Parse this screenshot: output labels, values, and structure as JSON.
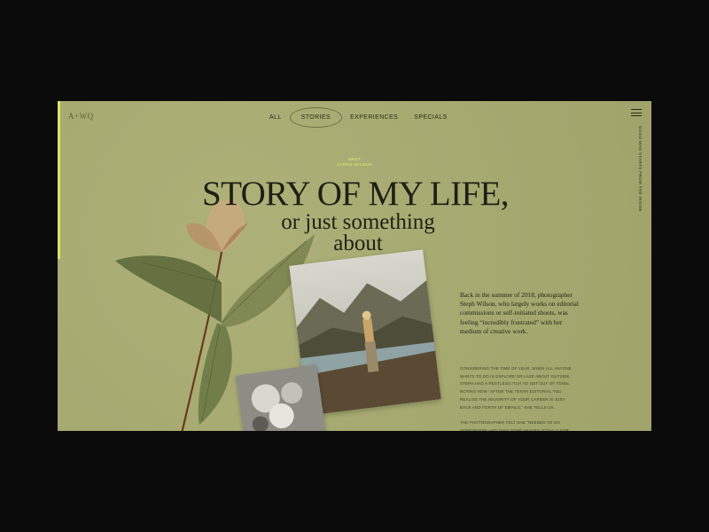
{
  "brand": {
    "logo": "A+WQ"
  },
  "nav": {
    "items": [
      "ALL",
      "STORIES",
      "EXPERIENCES",
      "SPECIALS"
    ],
    "active": "STORIES"
  },
  "side_text": "GOOD MAN STARTS FROM THE INSIDE",
  "hero": {
    "kicker_line1": "MEET",
    "kicker_line2": "STEPH WILSON",
    "title": "STORY OF MY LIFE,",
    "subtitle_line1": "or just something",
    "subtitle_line2": "about"
  },
  "article": {
    "intro": "Back in the summer of 2018, photographer Steph Wilson, who largely works on editorial commissions or self-initiated shoots, was feeling “incredibly frustrated” with her medium of creative work.",
    "para1": "Considering the time of year, when all anyone wants to do is explore or laze about outside, Steph had a restless itch to get out of town, noting how “after the tenth editorial you realise the majority of your career is just back and forth of emails,” she tells us.",
    "para2": "The photographer felt she “needed to go somewhere and take some images totally for me"
  },
  "colors": {
    "background": "#a8ac70",
    "accent": "#dde36a",
    "frame": "#0b0b0b",
    "text": "#1f1f14"
  }
}
